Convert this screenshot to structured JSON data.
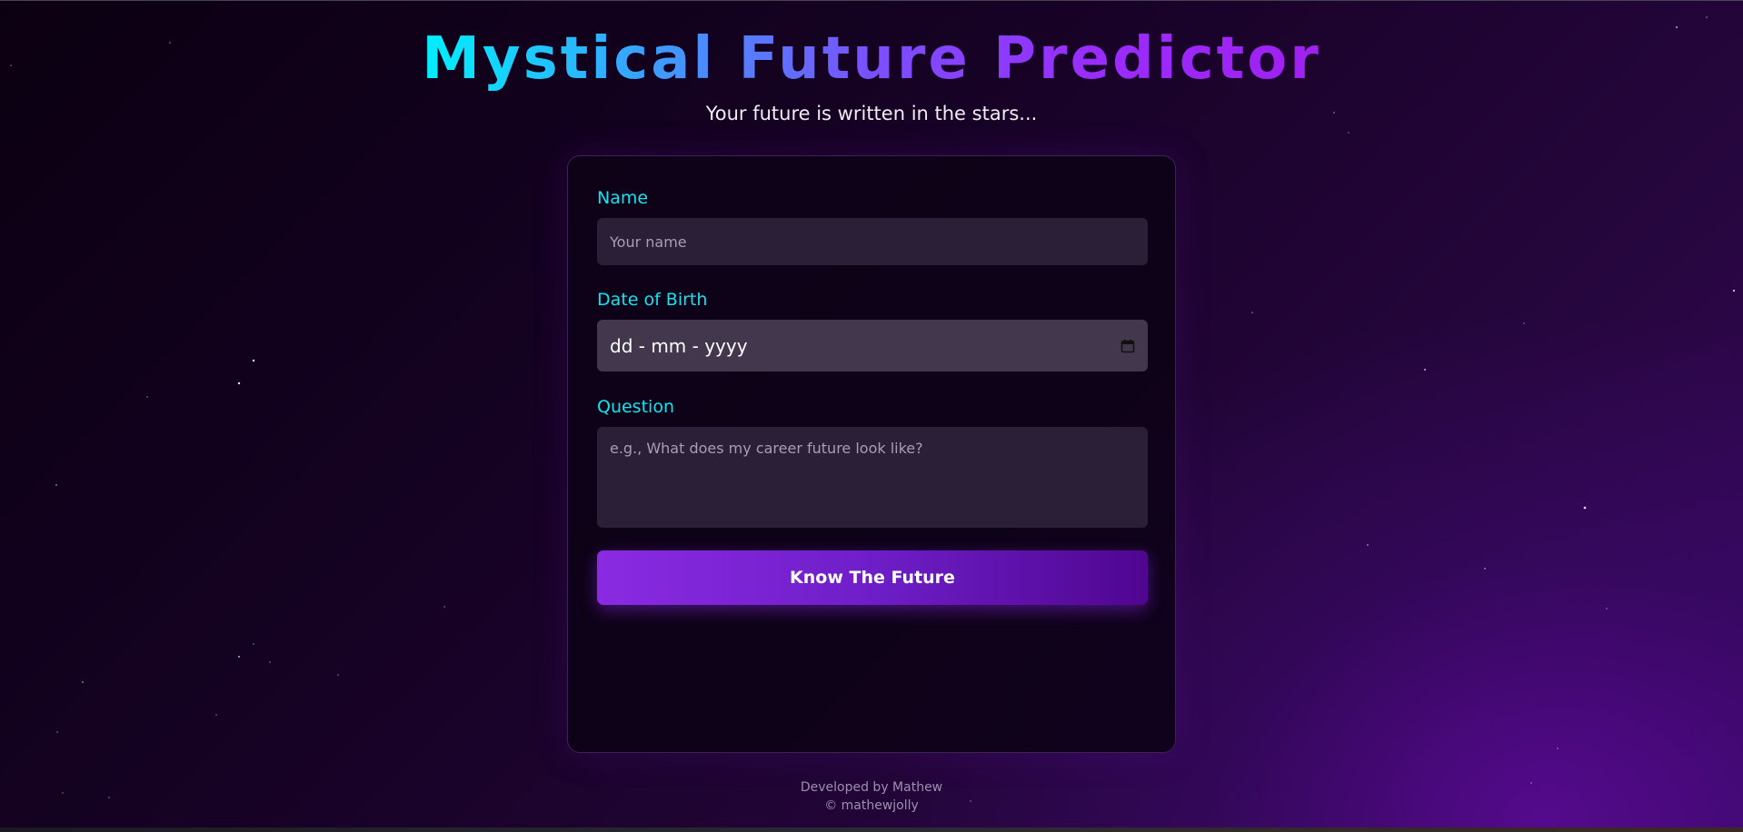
{
  "header": {
    "title": "Mystical Future Predictor",
    "subtitle": "Your future is written in the stars..."
  },
  "form": {
    "name": {
      "label": "Name",
      "placeholder": "Your name",
      "value": ""
    },
    "dob": {
      "label": "Date of Birth",
      "value": "dd - mm - yyyy",
      "icon": "calendar-icon"
    },
    "question": {
      "label": "Question",
      "placeholder": "e.g., What does my career future look like?",
      "value": ""
    },
    "submit_label": "Know The Future"
  },
  "footer": {
    "developed_by": "Developed by Mathew",
    "copyright": "© mathewjolly"
  },
  "colors": {
    "label": "#12e4ef",
    "button_start": "#8a2be2",
    "button_end": "#4f0690",
    "title_gradient": [
      "#00f0ff",
      "#7a50ff",
      "#a020f0"
    ]
  }
}
